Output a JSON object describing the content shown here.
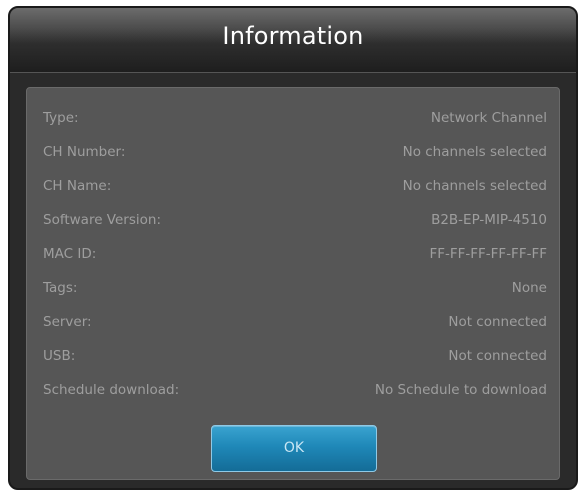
{
  "dialog": {
    "title": "Information",
    "rows": [
      {
        "label": "Type:",
        "value": "Network Channel"
      },
      {
        "label": "CH Number:",
        "value": "No channels selected"
      },
      {
        "label": "CH Name:",
        "value": "No channels selected"
      },
      {
        "label": "Software Version:",
        "value": "B2B-EP-MIP-4510"
      },
      {
        "label": "MAC ID:",
        "value": "FF-FF-FF-FF-FF-FF"
      },
      {
        "label": "Tags:",
        "value": "None"
      },
      {
        "label": "Server:",
        "value": "Not connected"
      },
      {
        "label": "USB:",
        "value": "Not connected"
      },
      {
        "label": "Schedule download:",
        "value": "No Schedule to download"
      }
    ],
    "ok_label": "OK"
  },
  "colors": {
    "accent": "#1f88b8",
    "panel": "#565656",
    "text": "#9e9e9e"
  }
}
